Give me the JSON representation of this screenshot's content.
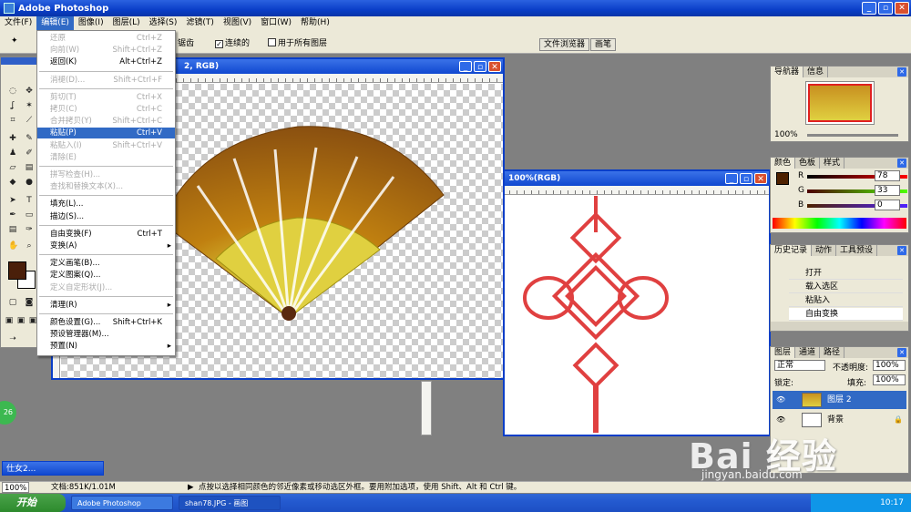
{
  "app": {
    "title": "Adobe Photoshop"
  },
  "menubar": [
    "文件(F)",
    "编辑(E)",
    "图像(I)",
    "图层(L)",
    "选择(S)",
    "滤镜(T)",
    "视图(V)",
    "窗口(W)",
    "帮助(H)"
  ],
  "options": {
    "antialias_tail": "锯齿",
    "contiguous": "连续的",
    "all_layers": "用于所有图层"
  },
  "palette_tabs": {
    "file_browser": "文件浏览器",
    "brushes": "画笔"
  },
  "edit_menu": [
    {
      "label": "还原",
      "shortcut": "Ctrl+Z",
      "disabled": true
    },
    {
      "label": "向前(W)",
      "shortcut": "Shift+Ctrl+Z",
      "disabled": true
    },
    {
      "label": "返回(K)",
      "shortcut": "Alt+Ctrl+Z",
      "disabled": false
    },
    {
      "sep": true
    },
    {
      "label": "消褪(D)...",
      "shortcut": "Shift+Ctrl+F",
      "disabled": true
    },
    {
      "sep": true
    },
    {
      "label": "剪切(T)",
      "shortcut": "Ctrl+X",
      "disabled": true
    },
    {
      "label": "拷贝(C)",
      "shortcut": "Ctrl+C",
      "disabled": true
    },
    {
      "label": "合并拷贝(Y)",
      "shortcut": "Shift+Ctrl+C",
      "disabled": true
    },
    {
      "label": "粘贴(P)",
      "shortcut": "Ctrl+V",
      "disabled": false,
      "highlight": true
    },
    {
      "label": "粘贴入(I)",
      "shortcut": "Shift+Ctrl+V",
      "disabled": true
    },
    {
      "label": "清除(E)",
      "shortcut": "",
      "disabled": true
    },
    {
      "sep": true
    },
    {
      "label": "拼写检查(H)...",
      "shortcut": "",
      "disabled": true
    },
    {
      "label": "查找和替换文本(X)...",
      "shortcut": "",
      "disabled": true
    },
    {
      "sep": true
    },
    {
      "label": "填充(L)...",
      "shortcut": "",
      "disabled": false
    },
    {
      "label": "描边(S)...",
      "shortcut": "",
      "disabled": false
    },
    {
      "sep": true
    },
    {
      "label": "自由变换(F)",
      "shortcut": "Ctrl+T",
      "disabled": false
    },
    {
      "label": "变换(A)",
      "shortcut": "",
      "disabled": false,
      "submenu": true
    },
    {
      "sep": true
    },
    {
      "label": "定义画笔(B)...",
      "shortcut": "",
      "disabled": false
    },
    {
      "label": "定义图案(Q)...",
      "shortcut": "",
      "disabled": false
    },
    {
      "label": "定义自定形状(J)...",
      "shortcut": "",
      "disabled": true
    },
    {
      "sep": true
    },
    {
      "label": "清理(R)",
      "shortcut": "",
      "disabled": false,
      "submenu": true
    },
    {
      "sep": true
    },
    {
      "label": "颜色设置(G)...",
      "shortcut": "Shift+Ctrl+K",
      "disabled": false
    },
    {
      "label": "预设管理器(M)...",
      "shortcut": "",
      "disabled": false
    },
    {
      "label": "预置(N)",
      "shortcut": "",
      "disabled": false,
      "submenu": true
    }
  ],
  "doc1": {
    "title_visible": "2, RGB)"
  },
  "doc2": {
    "title": "100%(RGB)"
  },
  "navigator": {
    "tabs": [
      "导航器",
      "信息"
    ],
    "zoom": "100%"
  },
  "color_panel": {
    "tabs": [
      "颜色",
      "色板",
      "样式"
    ],
    "r_label": "R",
    "g_label": "G",
    "b_label": "B",
    "r": "78",
    "g": "33",
    "b": "0",
    "swatch": "#4e2100"
  },
  "history_panel": {
    "tabs": [
      "历史记录",
      "动作",
      "工具预设"
    ],
    "items": [
      "打开",
      "载入选区",
      "粘贴入",
      "自由变换"
    ]
  },
  "layers_panel": {
    "tabs": [
      "图层",
      "通道",
      "路径"
    ],
    "blend_mode": "正常",
    "opacity_label": "不透明度:",
    "opacity": "100%",
    "lock_label": "锁定:",
    "fill_label": "填充:",
    "fill": "100%",
    "layers": [
      {
        "name": "图层 2",
        "selected": true
      },
      {
        "name": "背景",
        "selected": false
      }
    ]
  },
  "minimized_doc": {
    "title": "仕女2..."
  },
  "statusbar": {
    "zoom": "100%",
    "docsize": "文档:851K/1.01M",
    "hint": "点按以选择相同颜色的邻近像素或移动选区外框。要用附加选项，使用 Shift、Alt 和 Ctrl 键。"
  },
  "side_badge": "26",
  "taskbar": {
    "start": "开始",
    "tasks": [
      "Adobe Photoshop",
      "shan78.JPG - 画图"
    ],
    "clock": "10:17"
  },
  "watermark": {
    "brand": "Bai 经验",
    "url": "jingyan.baidu.com"
  }
}
